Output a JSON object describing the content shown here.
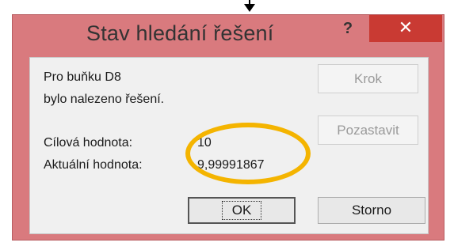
{
  "dialog": {
    "title": "Stav hledání řešení",
    "help_label": "?",
    "close_label": "✕",
    "message_line1": "Pro buňku D8",
    "message_line2": "bylo nalezeno řešení.",
    "target_label": "Cílová hodnota:",
    "target_value": "10",
    "current_label": "Aktuální hodnota:",
    "current_value": "9,99991867",
    "buttons": {
      "step": "Krok",
      "pause": "Pozastavit",
      "ok": "OK",
      "cancel": "Storno"
    }
  },
  "colors": {
    "titlebar": "#d97a7e",
    "close_button": "#c93a33",
    "highlight": "#f4b400"
  }
}
